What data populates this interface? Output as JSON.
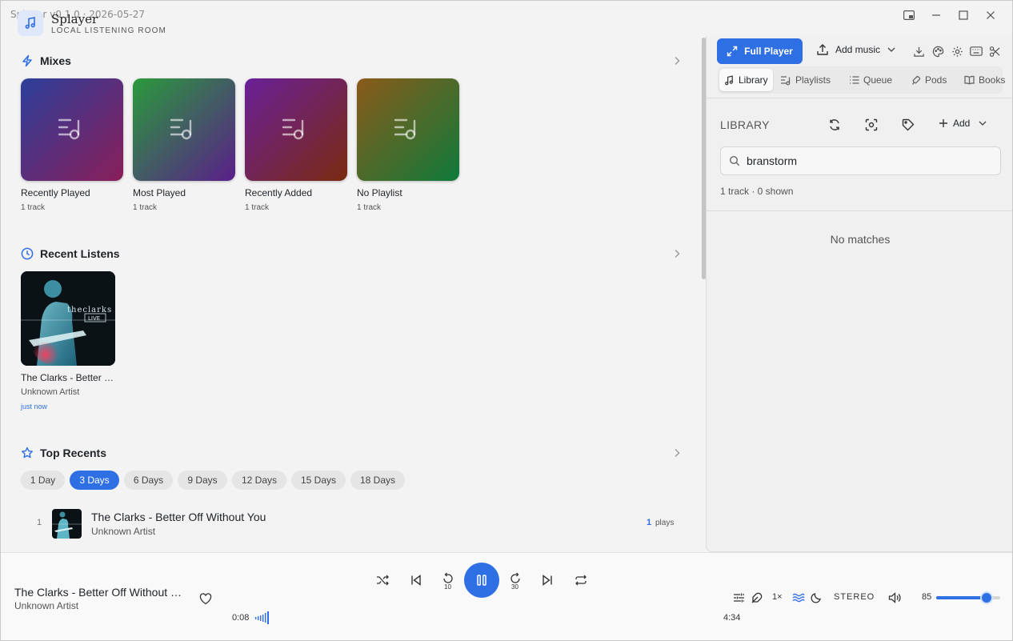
{
  "window": {
    "title": "Splayer v0.1.0 · 2026-05-27"
  },
  "app": {
    "name": "Splayer",
    "subtitle": "LOCAL LISTENING ROOM"
  },
  "mixes": {
    "title": "Mixes",
    "items": [
      {
        "label": "Recently Played",
        "count": "1 track",
        "gradient": [
          "#2c3f9a",
          "#8a1e5a"
        ]
      },
      {
        "label": "Most Played",
        "count": "1 track",
        "gradient": [
          "#2a9a3c",
          "#5a1f8a"
        ]
      },
      {
        "label": "Recently Added",
        "count": "1 track",
        "gradient": [
          "#6a2098",
          "#7a2a10"
        ]
      },
      {
        "label": "No Playlist",
        "count": "1 track",
        "gradient": [
          "#8a5a1a",
          "#0f7a3a"
        ]
      }
    ]
  },
  "recent_listens": {
    "title": "Recent Listens",
    "items": [
      {
        "title": "The Clarks - Better …",
        "artist": "Unknown Artist",
        "time": "just now",
        "art_text": "theclarks",
        "art_sub": "LIVE"
      }
    ]
  },
  "top_recents": {
    "title": "Top Recents",
    "ranges": [
      "1 Day",
      "3 Days",
      "6 Days",
      "9 Days",
      "12 Days",
      "15 Days",
      "18 Days"
    ],
    "active_range": "3 Days",
    "rows": [
      {
        "rank": "1",
        "title": "The Clarks - Better Off Without You",
        "artist": "Unknown Artist",
        "plays": "1",
        "plays_label": "plays"
      }
    ]
  },
  "panel": {
    "full_player_label": "Full Player",
    "add_music_label": "Add music",
    "tabs": [
      "Library",
      "Playlists",
      "Queue",
      "Pods",
      "Books"
    ],
    "active_tab": "Library",
    "library_title": "LIBRARY",
    "add_label": "Add",
    "search_value": "branstorm",
    "meta": "1 track · 0 shown",
    "empty": "No matches"
  },
  "player": {
    "title": "The Clarks - Better Off Without …",
    "artist": "Unknown Artist",
    "elapsed": "0:08",
    "duration": "4:34",
    "rewind_seconds": "10",
    "forward_seconds": "30",
    "speed": "1×",
    "channel_mode": "STEREO",
    "volume": "85",
    "volume_fraction": 0.79,
    "progress_fraction": 0.029,
    "accent": "#2f6fe4"
  }
}
